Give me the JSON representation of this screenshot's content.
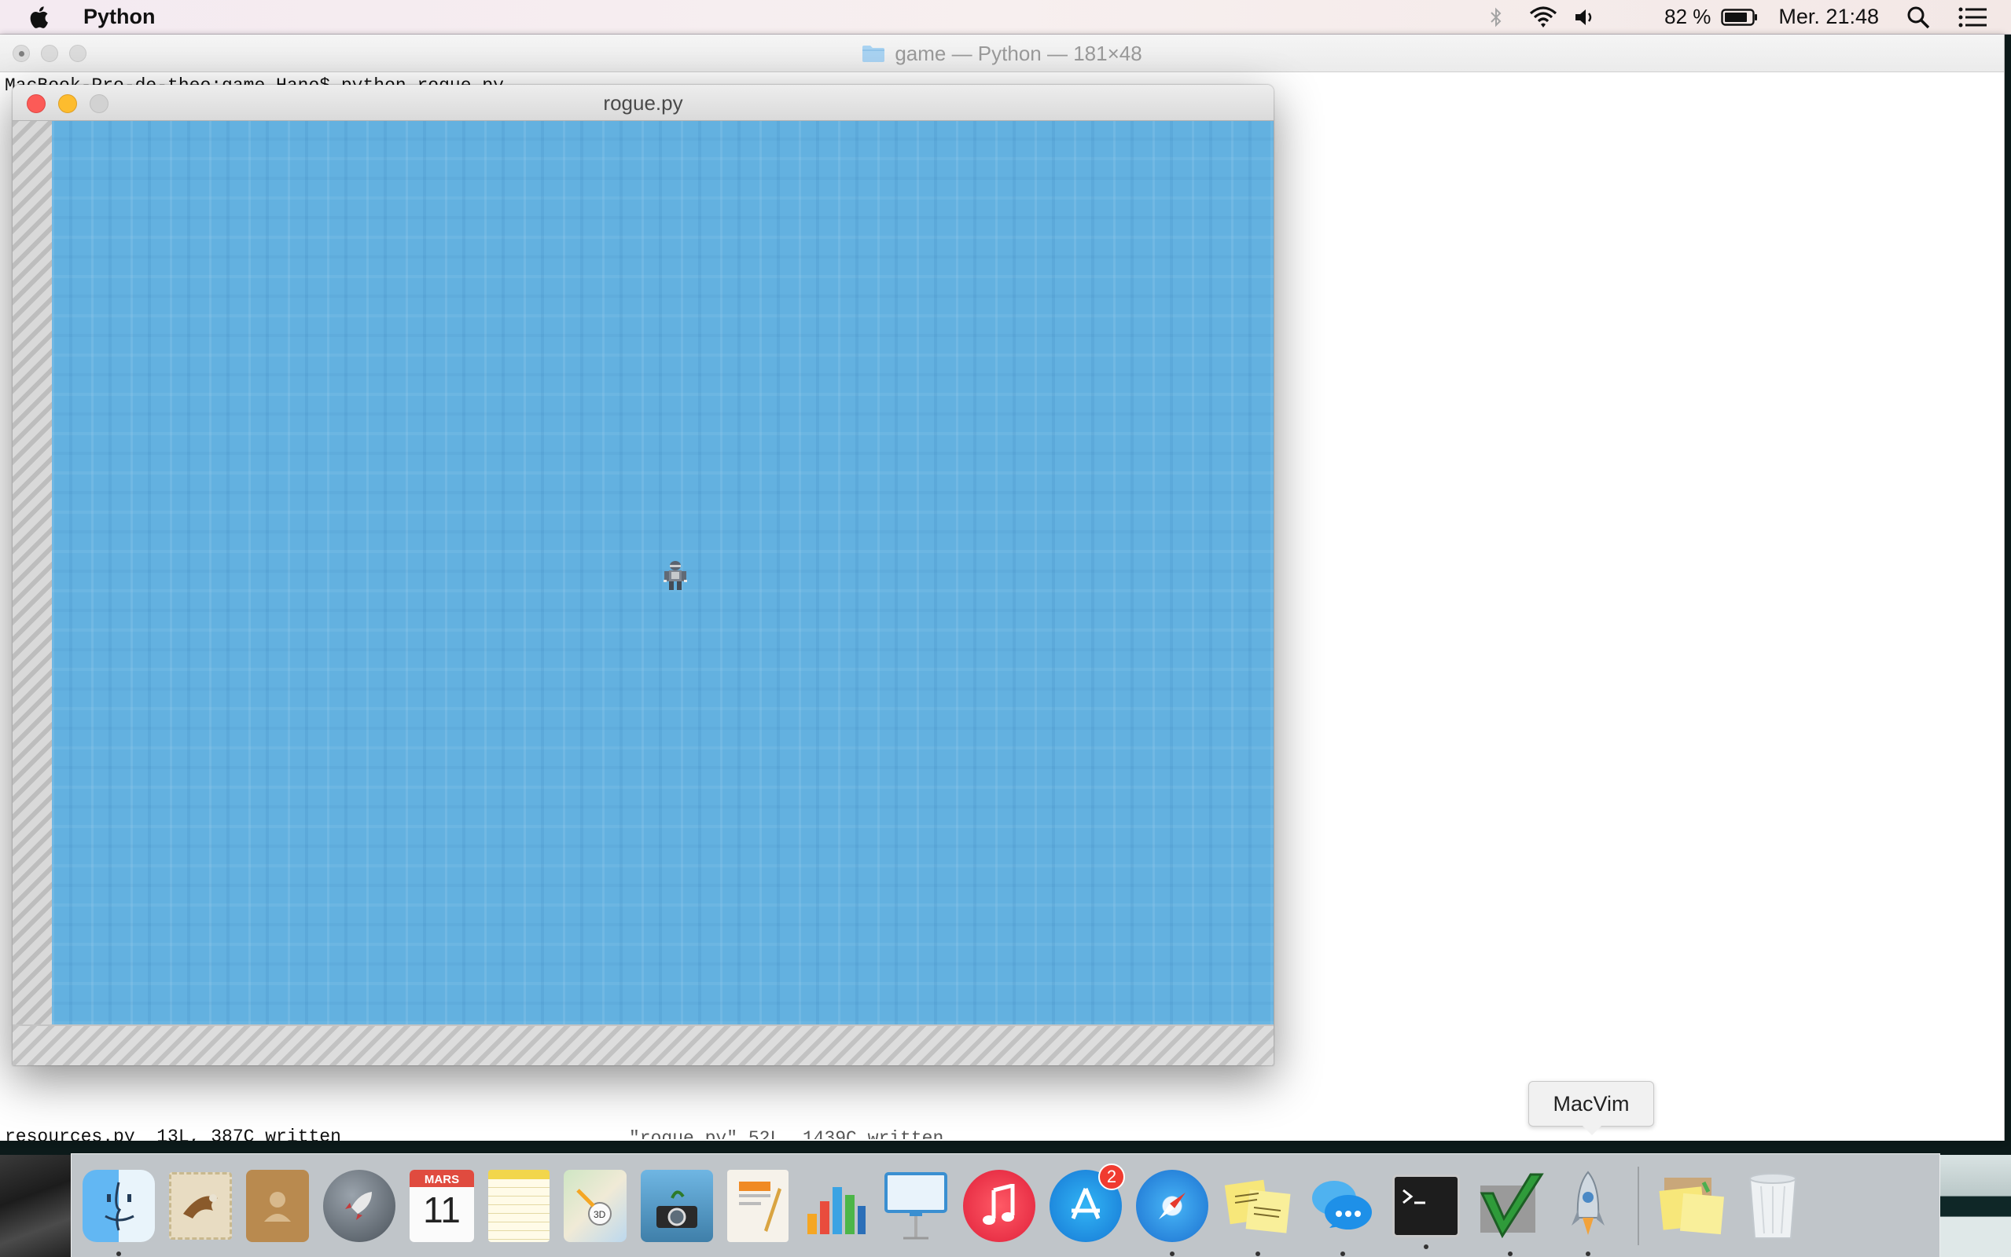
{
  "menubar": {
    "app_name": "Python",
    "battery_percent": "82 %",
    "clock": "Mer. 21:48"
  },
  "terminal": {
    "title": "game — Python — 181×48",
    "prompt_line": "MacBook-Pro-de-theo:game Hano$ python rogue.py",
    "bottom_line": "resources.py  13L, 387C written",
    "bottom_line_right": "\"rogue.py\" 52L, 1439C written"
  },
  "game_window": {
    "title": "rogue.py",
    "water_color": "#63b1e0",
    "wall_color": "#d0d0d0"
  },
  "tooltip": {
    "label": "MacVim"
  },
  "dock": {
    "calendar_month": "MARS",
    "calendar_day": "11",
    "app_store_badge": "2",
    "items": [
      "finder-icon",
      "mail-icon",
      "contacts-icon",
      "launchpad-icon",
      "calendar-icon",
      "notes-icon",
      "maps-icon",
      "photo-booth-icon",
      "pages-icon",
      "numbers-icon",
      "keynote-icon",
      "itunes-icon",
      "app-store-icon",
      "safari-icon",
      "stickies-icon",
      "messages-icon",
      "terminal-icon",
      "macvim-icon",
      "rocket-icon",
      "stickies-doc-icon",
      "trash-icon"
    ]
  }
}
